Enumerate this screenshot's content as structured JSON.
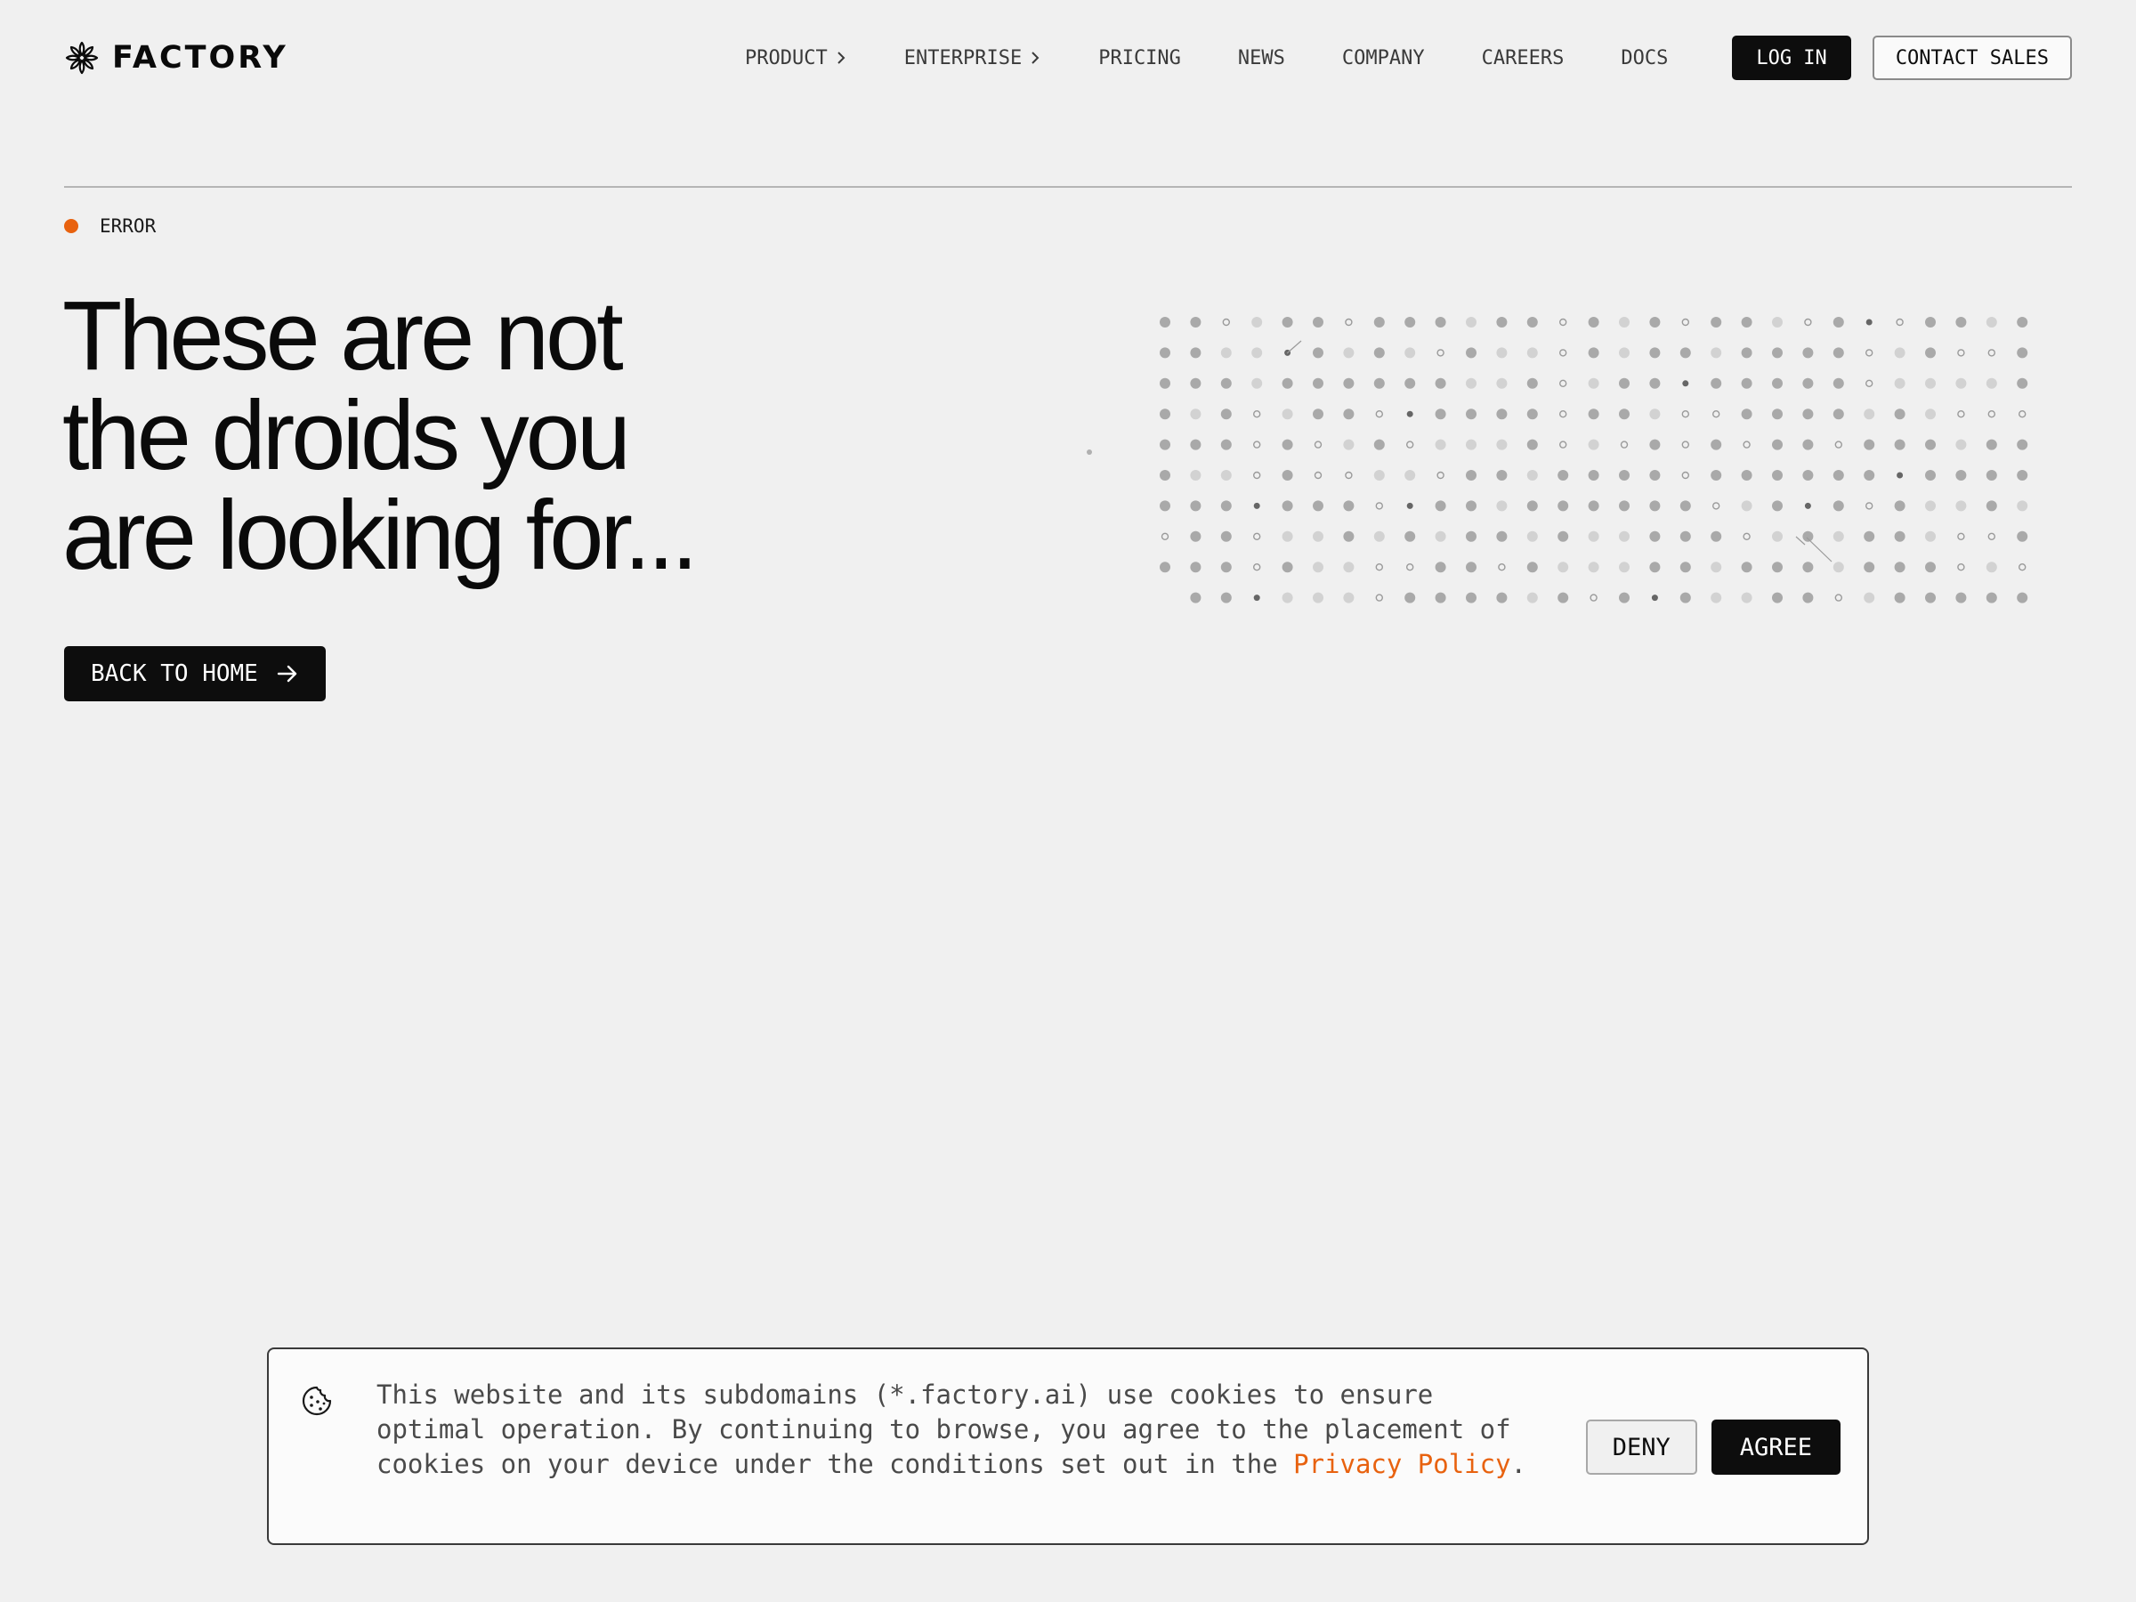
{
  "brand": {
    "name": "FACTORY",
    "logo_icon": "factory-star-icon"
  },
  "nav": {
    "links": [
      {
        "label": "PRODUCT",
        "has_chevron": true
      },
      {
        "label": "ENTERPRISE",
        "has_chevron": true
      },
      {
        "label": "PRICING",
        "has_chevron": false
      },
      {
        "label": "NEWS",
        "has_chevron": false
      },
      {
        "label": "COMPANY",
        "has_chevron": false
      },
      {
        "label": "CAREERS",
        "has_chevron": false
      },
      {
        "label": "DOCS",
        "has_chevron": false
      }
    ],
    "login_label": "LOG IN",
    "contact_label": "CONTACT SALES"
  },
  "hero": {
    "eyebrow": "ERROR",
    "headline_lines": [
      "These are not",
      "the droids you",
      "are looking for..."
    ],
    "cta_label": "BACK TO HOME",
    "cta_icon": "arrow-right-icon"
  },
  "cookie_banner": {
    "icon": "cookie-icon",
    "text": "This website and its subdomains (*.factory.ai) use cookies to ensure optimal operation. By continuing to browse, you agree to the placement of cookies on your device under the conditions set out in the ",
    "link_label": "Privacy Policy",
    "text_end": ".",
    "deny_label": "DENY",
    "agree_label": "AGREE"
  },
  "colors": {
    "accent": "#e8620f",
    "background": "#f0f0f0",
    "ink": "#0a0a0a"
  }
}
